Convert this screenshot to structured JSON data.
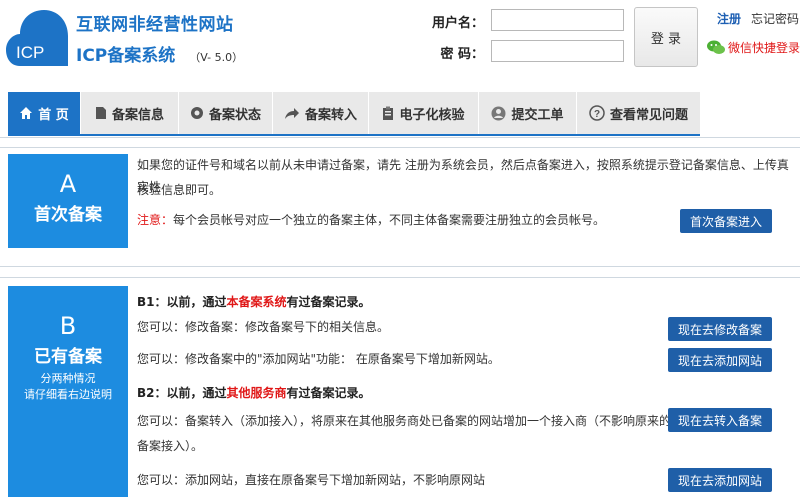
{
  "brand": {
    "logo_text": "ICP",
    "title": "互联网非经营性网站",
    "subtitle": "ICP备案系统",
    "version": "（V- 5.0）"
  },
  "login": {
    "username_label": "用户名：",
    "password_label": "密 码：",
    "username_value": "",
    "password_value": "",
    "login_button": "登 录",
    "register": "注册",
    "forgot": "忘记密码",
    "wechat": "微信快捷登录"
  },
  "nav": {
    "items": [
      {
        "label": "首 页",
        "icon": "home-icon"
      },
      {
        "label": "备案信息",
        "icon": "document-icon"
      },
      {
        "label": "备案状态",
        "icon": "gear-icon"
      },
      {
        "label": "备案转入",
        "icon": "share-arrow-icon"
      },
      {
        "label": "电子化核验",
        "icon": "clipboard-icon"
      },
      {
        "label": "提交工单",
        "icon": "user-icon"
      },
      {
        "label": "查看常见问题",
        "icon": "question-icon"
      }
    ]
  },
  "section_a": {
    "letter": "A",
    "title": "首次备案",
    "desc_line1": "如果您的证件号和域名以前从未申请过备案，请先 注册为系统会员，然后点备案进入，按照系统提示登记备案信息、上传真实性",
    "desc_line2": "核验信息即可。",
    "note_label": "注意：",
    "note_text": "每个会员帐号对应一个独立的备案主体，不同主体备案需要注册独立的会员帐号。",
    "button": "首次备案进入"
  },
  "section_b": {
    "letter": "B",
    "title": "已有备案",
    "sub1": "分两种情况",
    "sub2": "请仔细看右边说明",
    "b1_prefix": "B1：以前，通过",
    "b1_red": "本备案系统",
    "b1_suffix": "有过备案记录。",
    "b1_item1": "您可以：修改备案：修改备案号下的相关信息。",
    "b1_item2": "您可以：修改备案中的\"添加网站\"功能： 在原备案号下增加新网站。",
    "b2_prefix": "B2：以前，通过",
    "b2_red": "其他服务商",
    "b2_suffix": "有过备案记录。",
    "b2_item1_line1": "您可以：备案转入（添加接入），将原来在其他服务商处已备案的网站增加一个接入商（不影响原来的",
    "b2_item1_line2": "备案接入）。",
    "b2_item2": "您可以：添加网站，直接在原备案号下增加新网站，不影响原网站",
    "btn_modify": "现在去修改备案",
    "btn_add_site": "现在去添加网站",
    "btn_transfer": "现在去转入备案",
    "btn_add_site2": "现在去添加网站"
  },
  "colors": {
    "brand_blue": "#1d73c6",
    "panel_blue": "#1d8ce0",
    "button_blue": "#1f5fa8",
    "red": "#e01818"
  }
}
